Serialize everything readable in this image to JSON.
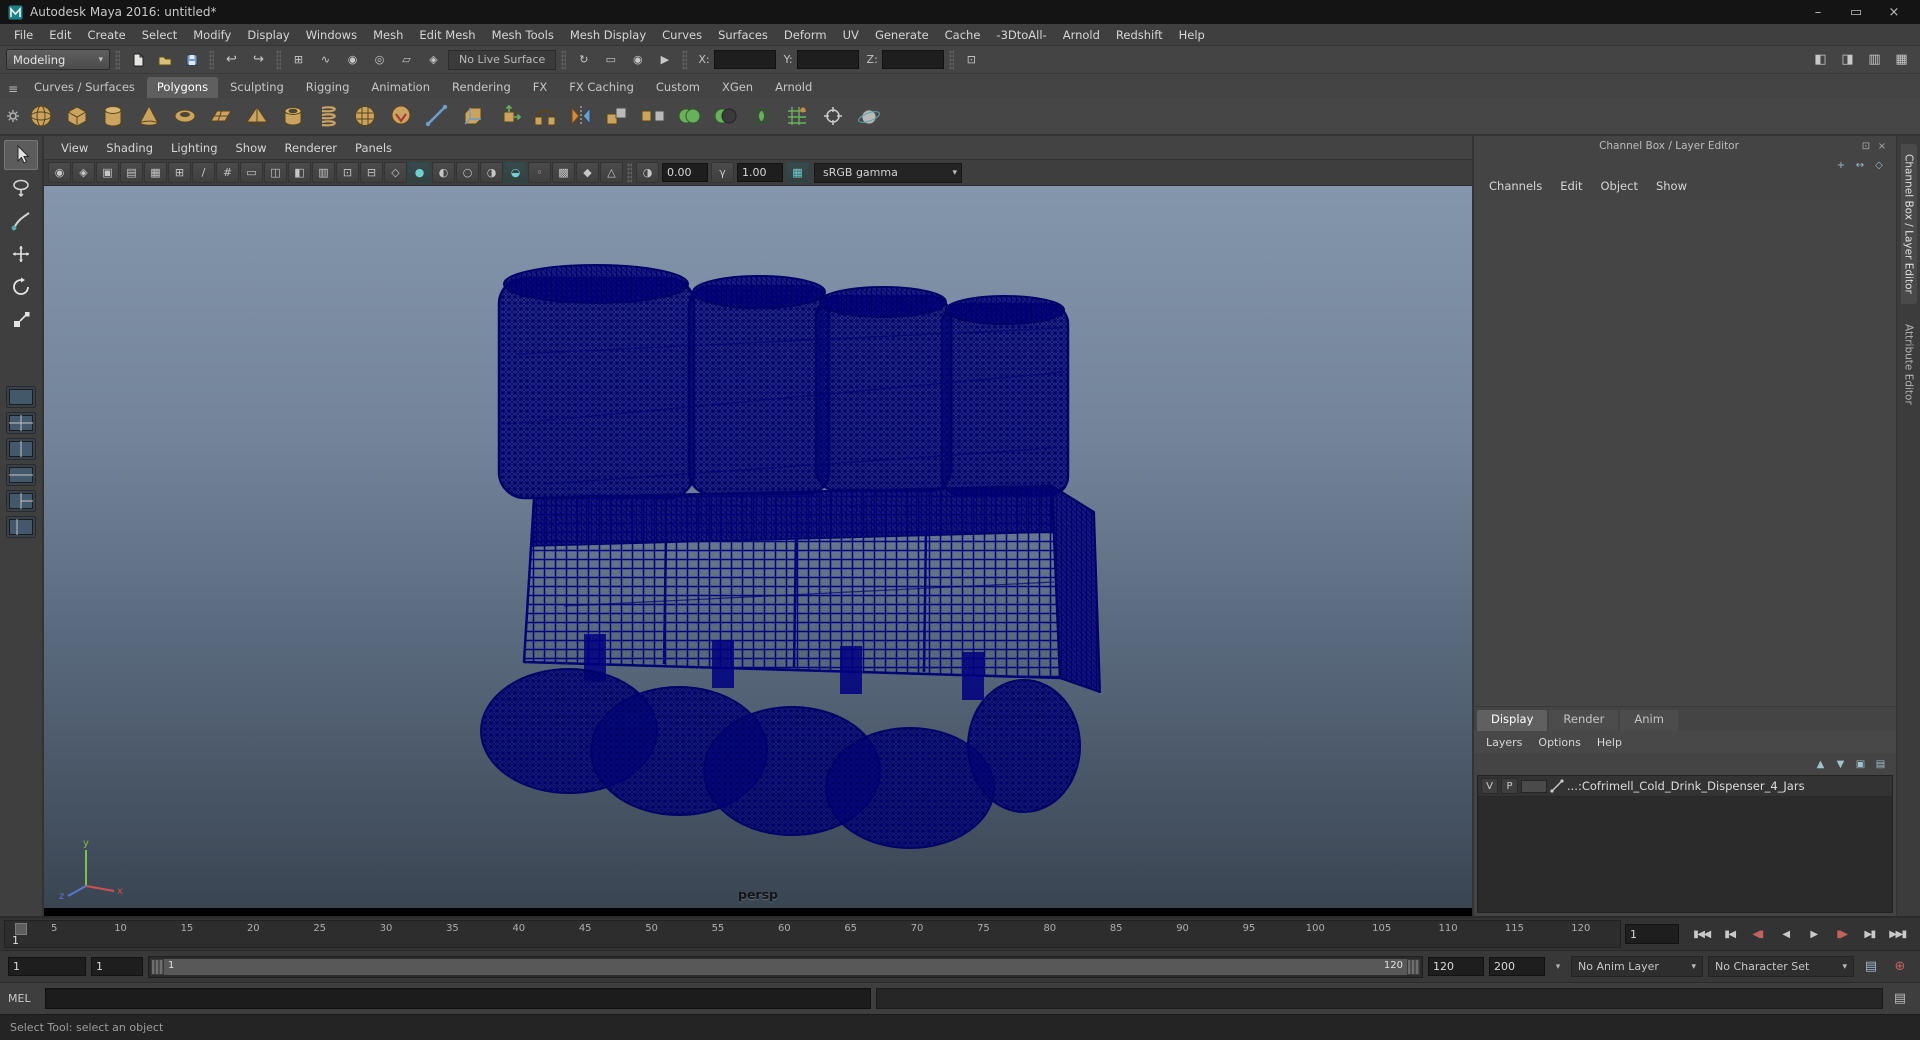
{
  "window": {
    "title": "Autodesk Maya 2016: untitled*"
  },
  "icons": {
    "minimize": "–",
    "maximize": "▭",
    "close": "×",
    "float": "⊡",
    "chevron_down": "▾",
    "shelf_menu": "≡",
    "undo": "↩",
    "redo": "↪",
    "snap_grid": "⊞",
    "snap_curve": "∿",
    "snap_point": "◉",
    "snap_center": "◎",
    "snap_plane": "▱",
    "make_live": "◈",
    "history": "↻",
    "render_view": "▭",
    "quick_render": "◉",
    "ipr_render": "▶",
    "selection_grid": "⊡",
    "toggle_modeling_toolkit": "◧",
    "toggle_attr_editor": "◨",
    "toggle_tool_settings": "▥",
    "toggle_channel_box": "▦",
    "panel_toolbar": [
      "◉",
      "◈",
      "▣",
      "▤",
      "▦",
      "⊞",
      "/",
      "#",
      "▭",
      "◫",
      "◧",
      "▥",
      "⊡",
      "⊟",
      "◇",
      "●",
      "◐",
      "○",
      "◑",
      "◒",
      "◦",
      "▩",
      "◆",
      "△"
    ],
    "exposure": "◑",
    "gamma": "γ",
    "color_mgmt": "▦",
    "cb_manip": "+",
    "cb_speed": "↔",
    "cb_hyper": "◇",
    "layer_up": "▲",
    "layer_down": "▼",
    "layer_new": "▣",
    "layer_new_sel": "▤",
    "anim_layer": "▤",
    "character_set": "⊕",
    "script_editor": "▤",
    "playback": [
      "▮◀◀",
      "▮◀",
      "◀▮",
      "◀",
      "▶",
      "▮▶",
      "▶▮",
      "▶▶▮"
    ]
  },
  "menubar": {
    "items": [
      "File",
      "Edit",
      "Create",
      "Select",
      "Modify",
      "Display",
      "Windows",
      "Mesh",
      "Edit Mesh",
      "Mesh Tools",
      "Mesh Display",
      "Curves",
      "Surfaces",
      "Deform",
      "UV",
      "Generate",
      "Cache",
      "-3DtoAll-",
      "Arnold",
      "Redshift",
      "Help"
    ]
  },
  "status": {
    "menu_set": "Modeling",
    "live_surface": "No Live Surface",
    "x_label": "X:",
    "y_label": "Y:",
    "z_label": "Z:",
    "x_value": "",
    "y_value": "",
    "z_value": ""
  },
  "shelf": {
    "tabs": [
      "Curves / Surfaces",
      "Polygons",
      "Sculpting",
      "Rigging",
      "Animation",
      "Rendering",
      "FX",
      "FX Caching",
      "Custom",
      "XGen",
      "Arnold"
    ],
    "active_tab": "Polygons"
  },
  "panel": {
    "menus": [
      "View",
      "Shading",
      "Lighting",
      "Show",
      "Renderer",
      "Panels"
    ],
    "exposure": "0.00",
    "gamma": "1.00",
    "view_transform": "sRGB gamma",
    "camera": "persp",
    "axis": {
      "x": "x",
      "y": "y",
      "z": "z"
    }
  },
  "channel_box": {
    "title": "Channel Box / Layer Editor",
    "menus": [
      "Channels",
      "Edit",
      "Object",
      "Show"
    ]
  },
  "layer_editor": {
    "tabs": [
      "Display",
      "Render",
      "Anim"
    ],
    "active_tab": "Display",
    "menus": [
      "Layers",
      "Options",
      "Help"
    ],
    "layer": {
      "visibility": "V",
      "playback": "P",
      "name": "...:Cofrimell_Cold_Drink_Dispenser_4_Jars"
    }
  },
  "sidebar": {
    "tabs": [
      "Channel Box / Layer Editor",
      "Attribute Editor"
    ]
  },
  "timeline": {
    "ticks": [
      "5",
      "10",
      "15",
      "20",
      "25",
      "30",
      "35",
      "40",
      "45",
      "50",
      "55",
      "60",
      "65",
      "70",
      "75",
      "80",
      "85",
      "90",
      "95",
      "100",
      "105",
      "110",
      "115",
      "120"
    ],
    "playhead": "1",
    "current_frame": "1"
  },
  "range": {
    "anim_start": "1",
    "playback_start": "1",
    "bar_start": "1",
    "bar_end": "120",
    "playback_end": "120",
    "anim_end": "200",
    "anim_layer": "No Anim Layer",
    "character_set": "No Character Set"
  },
  "command": {
    "label": "MEL",
    "input": "",
    "output": ""
  },
  "help": {
    "text": "Select Tool: select an object"
  },
  "colors": {
    "chrome": "#444444",
    "titlebar": "#141414",
    "field": "#1e1e1e",
    "viewport_top": "#8496ac",
    "viewport_bottom": "#3a4552",
    "wireframe": "#000080",
    "accent_teal": "#6fd0cd",
    "axis_x": "#cf5050",
    "axis_y": "#7fbf4d",
    "axis_z": "#5577cf"
  }
}
